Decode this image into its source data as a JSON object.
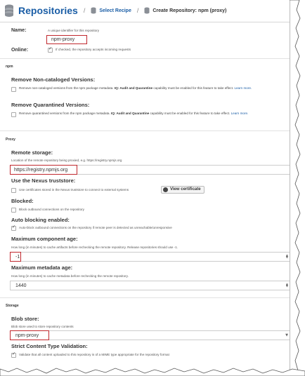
{
  "header": {
    "title": "Repositories",
    "crumb1": "Select Recipe",
    "crumb2": "Create Repository: npm (proxy)",
    "separator": "/"
  },
  "form": {
    "name_label": "Name:",
    "name_help": "A unique identifier for this repository",
    "name_value": "npm-proxy",
    "online_label": "Online:",
    "online_text": "If checked, the repository accepts incoming requests"
  },
  "npm": {
    "section": "npm",
    "remove_noncat_title": "Remove Non-cataloged Versions:",
    "remove_noncat_text": "Remove non-cataloged versions from the npm package metadata.",
    "remove_noncat_bold": "IQ: Audit and Quarantine",
    "remove_noncat_tail": "capability must be enabled for this feature to take effect.",
    "learn_more": "Learn more.",
    "remove_quar_title": "Remove Quarantined Versions:",
    "remove_quar_text": "Remove quarantined versions from the npm package metadata.",
    "remove_quar_bold": "IQ: Audit and Quarantine",
    "remove_quar_tail": "capability must be enabled for this feature to take effect.",
    "learn_more2": "Learn more."
  },
  "proxy": {
    "section": "Proxy",
    "remote_title": "Remote storage:",
    "remote_help": "Location of the remote repository being proxied, e.g. https://registry.npmjs.org",
    "remote_value": "https://registry.npmjs.org",
    "truststore_title": "Use the Nexus truststore:",
    "truststore_text": "Use certificates stored in the Nexus truststore to connect to external systems",
    "view_cert": "View certificate",
    "blocked_title": "Blocked:",
    "blocked_text": "Block outbound connections on the repository",
    "autoblock_title": "Auto blocking enabled:",
    "autoblock_text": "Auto-block outbound connections on the repository if remote peer is detected as unreachable/unresponsive",
    "max_comp_title": "Maximum component age:",
    "max_comp_help": "How long (in minutes) to cache artifacts before rechecking the remote repository. Release repositories should use -1.",
    "max_comp_value": "-1",
    "max_meta_title": "Maximum metadata age:",
    "max_meta_help": "How long (in minutes) to cache metadata before rechecking the remote repository.",
    "max_meta_value": "1440"
  },
  "storage": {
    "section": "Storage",
    "blob_title": "Blob store:",
    "blob_help": "Blob store used to store repository contents",
    "blob_value": "npm-proxy",
    "strict_title": "Strict Content Type Validation:",
    "strict_text": "Validate that all content uploaded to this repository is of a MIME type appropriate for the repository format"
  },
  "colors": {
    "accent": "#1b5ea6",
    "highlight": "#c0272d"
  },
  "icons": {
    "header": "database-icon",
    "crumb": "database-icon",
    "cert": "eye-icon",
    "check": "checkmark-icon"
  }
}
